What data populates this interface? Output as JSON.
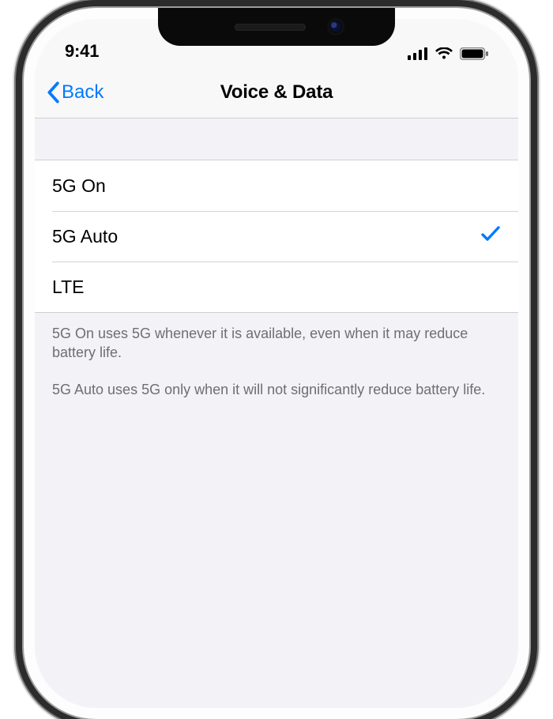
{
  "status": {
    "time": "9:41"
  },
  "nav": {
    "back_label": "Back",
    "title": "Voice & Data"
  },
  "options": [
    {
      "label": "5G On",
      "selected": false
    },
    {
      "label": "5G Auto",
      "selected": true
    },
    {
      "label": "LTE",
      "selected": false
    }
  ],
  "footer": {
    "line1": "5G On uses 5G whenever it is available, even when it may reduce battery life.",
    "line2": "5G Auto uses 5G only when it will not significantly reduce battery life."
  },
  "colors": {
    "accent": "#007aff",
    "bg_grouped": "#f2f2f7",
    "separator": "#cfcfd3",
    "secondary_text": "#6e6e73"
  }
}
